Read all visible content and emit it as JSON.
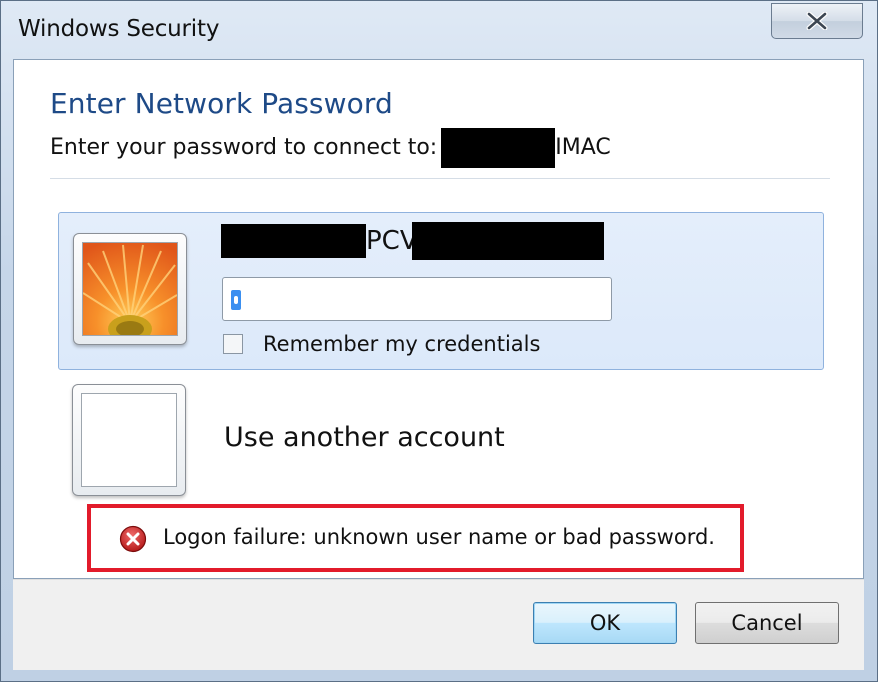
{
  "window": {
    "title": "Windows Security",
    "close_glyph": "✕"
  },
  "header": {
    "title": "Enter Network Password",
    "subtitle_prefix": "Enter your password to connect to:",
    "server_suffix": "IMAC"
  },
  "credential": {
    "user_middle": "PCV",
    "password_value": "",
    "password_placeholder": "",
    "remember_label": "Remember my credentials",
    "remember_checked": false,
    "avatar_icon": "orange-flower-avatar-icon"
  },
  "another_account": {
    "label": "Use another account",
    "icon": "blank-avatar-icon"
  },
  "error": {
    "message": "Logon failure: unknown user name or bad password.",
    "icon": "error-x-icon",
    "color": "#e21b2b"
  },
  "buttons": {
    "ok": "OK",
    "cancel": "Cancel"
  },
  "colors": {
    "accent_title": "#1e4a87",
    "tile_bg": "#dce9fa",
    "highlight": "#e21b2b"
  }
}
